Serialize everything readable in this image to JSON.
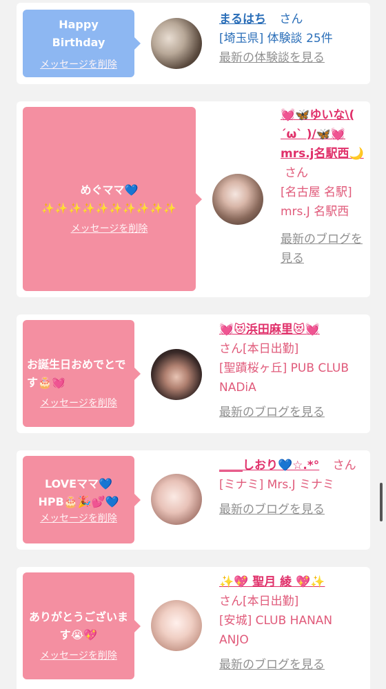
{
  "delete_label": "メッセージを削除",
  "cards": [
    {
      "message": "Happy\nBirthday",
      "name": "まるはち",
      "suffix": "さん",
      "meta": "[埼玉県] 体験談 25件",
      "link": "最新の体験談を見る",
      "bubble_color": "#8db7f2"
    },
    {
      "message": "めぐママ",
      "message_icons": "💙",
      "sparkles": "✨✨✨✨✨✨✨✨✨✨",
      "name": "💓🦋ゆいな\\( ´ω` )/🦋💓mrs.j名駅西🌙",
      "suffix": "さん",
      "meta": "[名古屋 名駅] mrs.J 名駅西",
      "link": "最新のブログを見る",
      "bubble_color": "#f48fa1"
    },
    {
      "message": "お誕生日おめでとです",
      "message_icons": "🎂💓",
      "name": "💓😻浜田麻里😻💓",
      "suffix": "さん[本日出勤]",
      "meta": "[聖蹟桜ヶ丘] PUB CLUB NADiA",
      "link": "最新のブログを見る",
      "bubble_color": "#f48fa1"
    },
    {
      "message": "LOVEママ💙\nHPB🎂🎉💕💙",
      "name": "____しおり💙☆.*°",
      "suffix": "さん",
      "meta": "[ミナミ] Mrs.J ミナミ",
      "link": "最新のブログを見る",
      "bubble_color": "#f48fa1"
    },
    {
      "message": "ありがとうございます",
      "message_icons": "😭💖",
      "name": "✨💖 聖月 綾 💖✨",
      "suffix": "さん[本日出勤]",
      "meta": "[安城] CLUB HANAN ANJO",
      "link": "最新のブログを見る",
      "bubble_color": "#f48fa1"
    }
  ]
}
